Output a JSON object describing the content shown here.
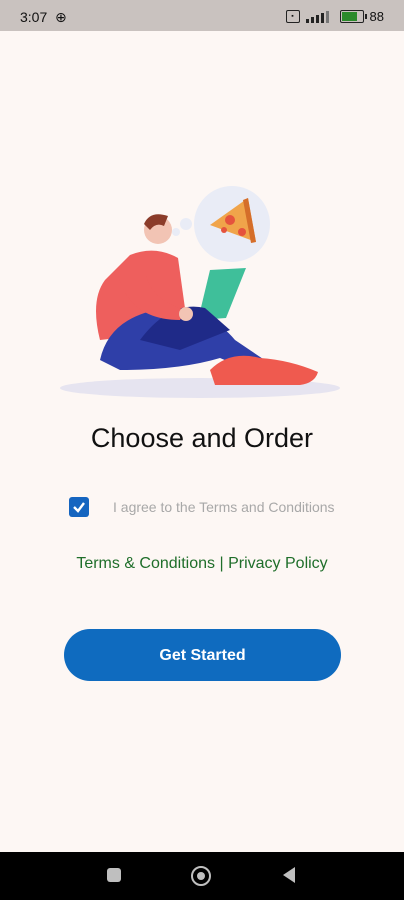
{
  "status_bar": {
    "time": "3:07",
    "battery_text": "88",
    "icons": [
      "globe-icon",
      "sim-icon",
      "signal-icon",
      "battery-icon"
    ]
  },
  "main": {
    "title": "Choose and Order",
    "agree_label": "I agree to the Terms and Conditions",
    "agree_checked": true,
    "terms_link": "Terms & Conditions",
    "separator": "|",
    "privacy_link": "Privacy Policy",
    "cta_label": "Get Started"
  },
  "colors": {
    "background": "#fdf7f4",
    "primary": "#0f6bbf",
    "link": "#1f6e2a",
    "muted": "#a8a8a8"
  },
  "nav_bar": {
    "icons": [
      "recents-icon",
      "home-icon",
      "back-icon"
    ]
  }
}
